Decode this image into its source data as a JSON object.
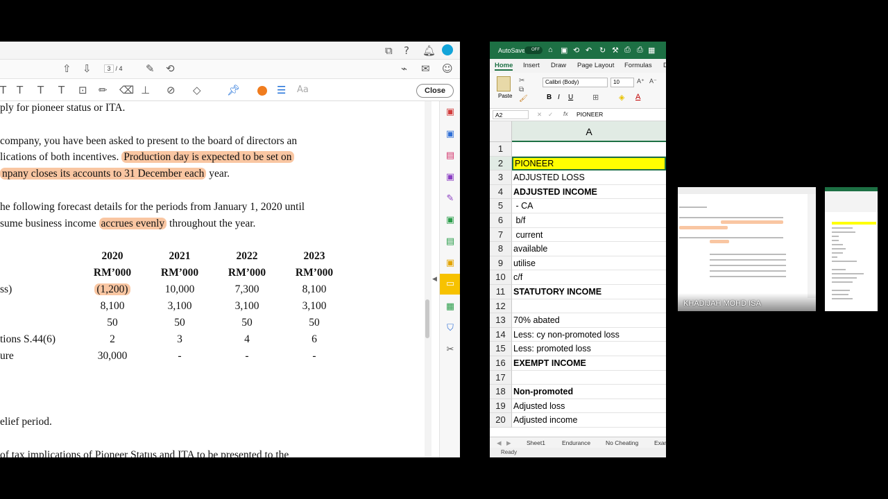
{
  "pdf": {
    "page_current": "3",
    "page_total": "/ 4",
    "close_label": "Close",
    "text_size_label": "Aa",
    "lines": {
      "l1": "ply for pioneer status or ITA.",
      "l2": "company, you have been asked to present to the board of directors an",
      "l3a": "lications of both incentives.",
      "l3b": "Production day is expected to be set on",
      "l4a": "npany closes its accounts to 31 December each",
      "l4b": "year.",
      "l5": "he following forecast details for the periods from January 1, 2020 until",
      "l6a": "sume business income",
      "l6b": "accrues evenly",
      "l6c": "throughout the year.",
      "l_relief": "elief period.",
      "l_last": "of tax implications of Pioneer Status and ITA to be presented to the"
    },
    "table": {
      "years": [
        "2020",
        "2021",
        "2022",
        "2023"
      ],
      "unit": "RM’000",
      "row_labels": [
        "ss)",
        "",
        "",
        "tions S.44(6)",
        "ure"
      ],
      "rows": [
        [
          "(1,200)",
          "10,000",
          "7,300",
          "8,100"
        ],
        [
          "8,100",
          "3,100",
          "3,100",
          "3,100"
        ],
        [
          "50",
          "50",
          "50",
          "50"
        ],
        [
          "2",
          "3",
          "4",
          "6"
        ],
        [
          "30,000",
          "-",
          "-",
          "-"
        ]
      ]
    }
  },
  "excel": {
    "autosave_label": "AutoSave",
    "autosave_state": "OFF",
    "tabs": [
      "Home",
      "Insert",
      "Draw",
      "Page Layout",
      "Formulas",
      "D"
    ],
    "paste_label": "Paste",
    "font_name": "Calibri (Body)",
    "font_size": "10",
    "name_box": "A2",
    "formula": "PIONEER",
    "fx_label": "fx",
    "column_header": "A",
    "rows": [
      {
        "n": "1",
        "v": ""
      },
      {
        "n": "2",
        "v": "PIONEER"
      },
      {
        "n": "3",
        "v": "ADJUSTED LOSS"
      },
      {
        "n": "4",
        "v": "ADJUSTED INCOME"
      },
      {
        "n": "5",
        "v": " - CA"
      },
      {
        "n": "6",
        "v": " b/f"
      },
      {
        "n": "7",
        "v": " current"
      },
      {
        "n": "8",
        "v": "available"
      },
      {
        "n": "9",
        "v": "utilise"
      },
      {
        "n": "10",
        "v": "c/f"
      },
      {
        "n": "11",
        "v": "STATUTORY INCOME"
      },
      {
        "n": "12",
        "v": ""
      },
      {
        "n": "13",
        "v": "70% abated"
      },
      {
        "n": "14",
        "v": "Less: cy non-promoted loss"
      },
      {
        "n": "15",
        "v": "Less: promoted loss"
      },
      {
        "n": "16",
        "v": "EXEMPT INCOME"
      },
      {
        "n": "17",
        "v": ""
      },
      {
        "n": "18",
        "v": "Non-promoted"
      },
      {
        "n": "19",
        "v": "Adjusted loss"
      },
      {
        "n": "20",
        "v": "Adjusted income"
      }
    ],
    "sheets": [
      "Sheet1",
      "Endurance",
      "No Cheating",
      "Exam"
    ],
    "status": "Ready"
  },
  "participants": {
    "p1_name": "KHADIJAH MOHD ISA"
  },
  "colors": {
    "highlight": "#f9c6a2",
    "excel_green": "#1d7044",
    "selected_cell": "#ffff00",
    "acrobat_accent": "#f07c1e"
  }
}
